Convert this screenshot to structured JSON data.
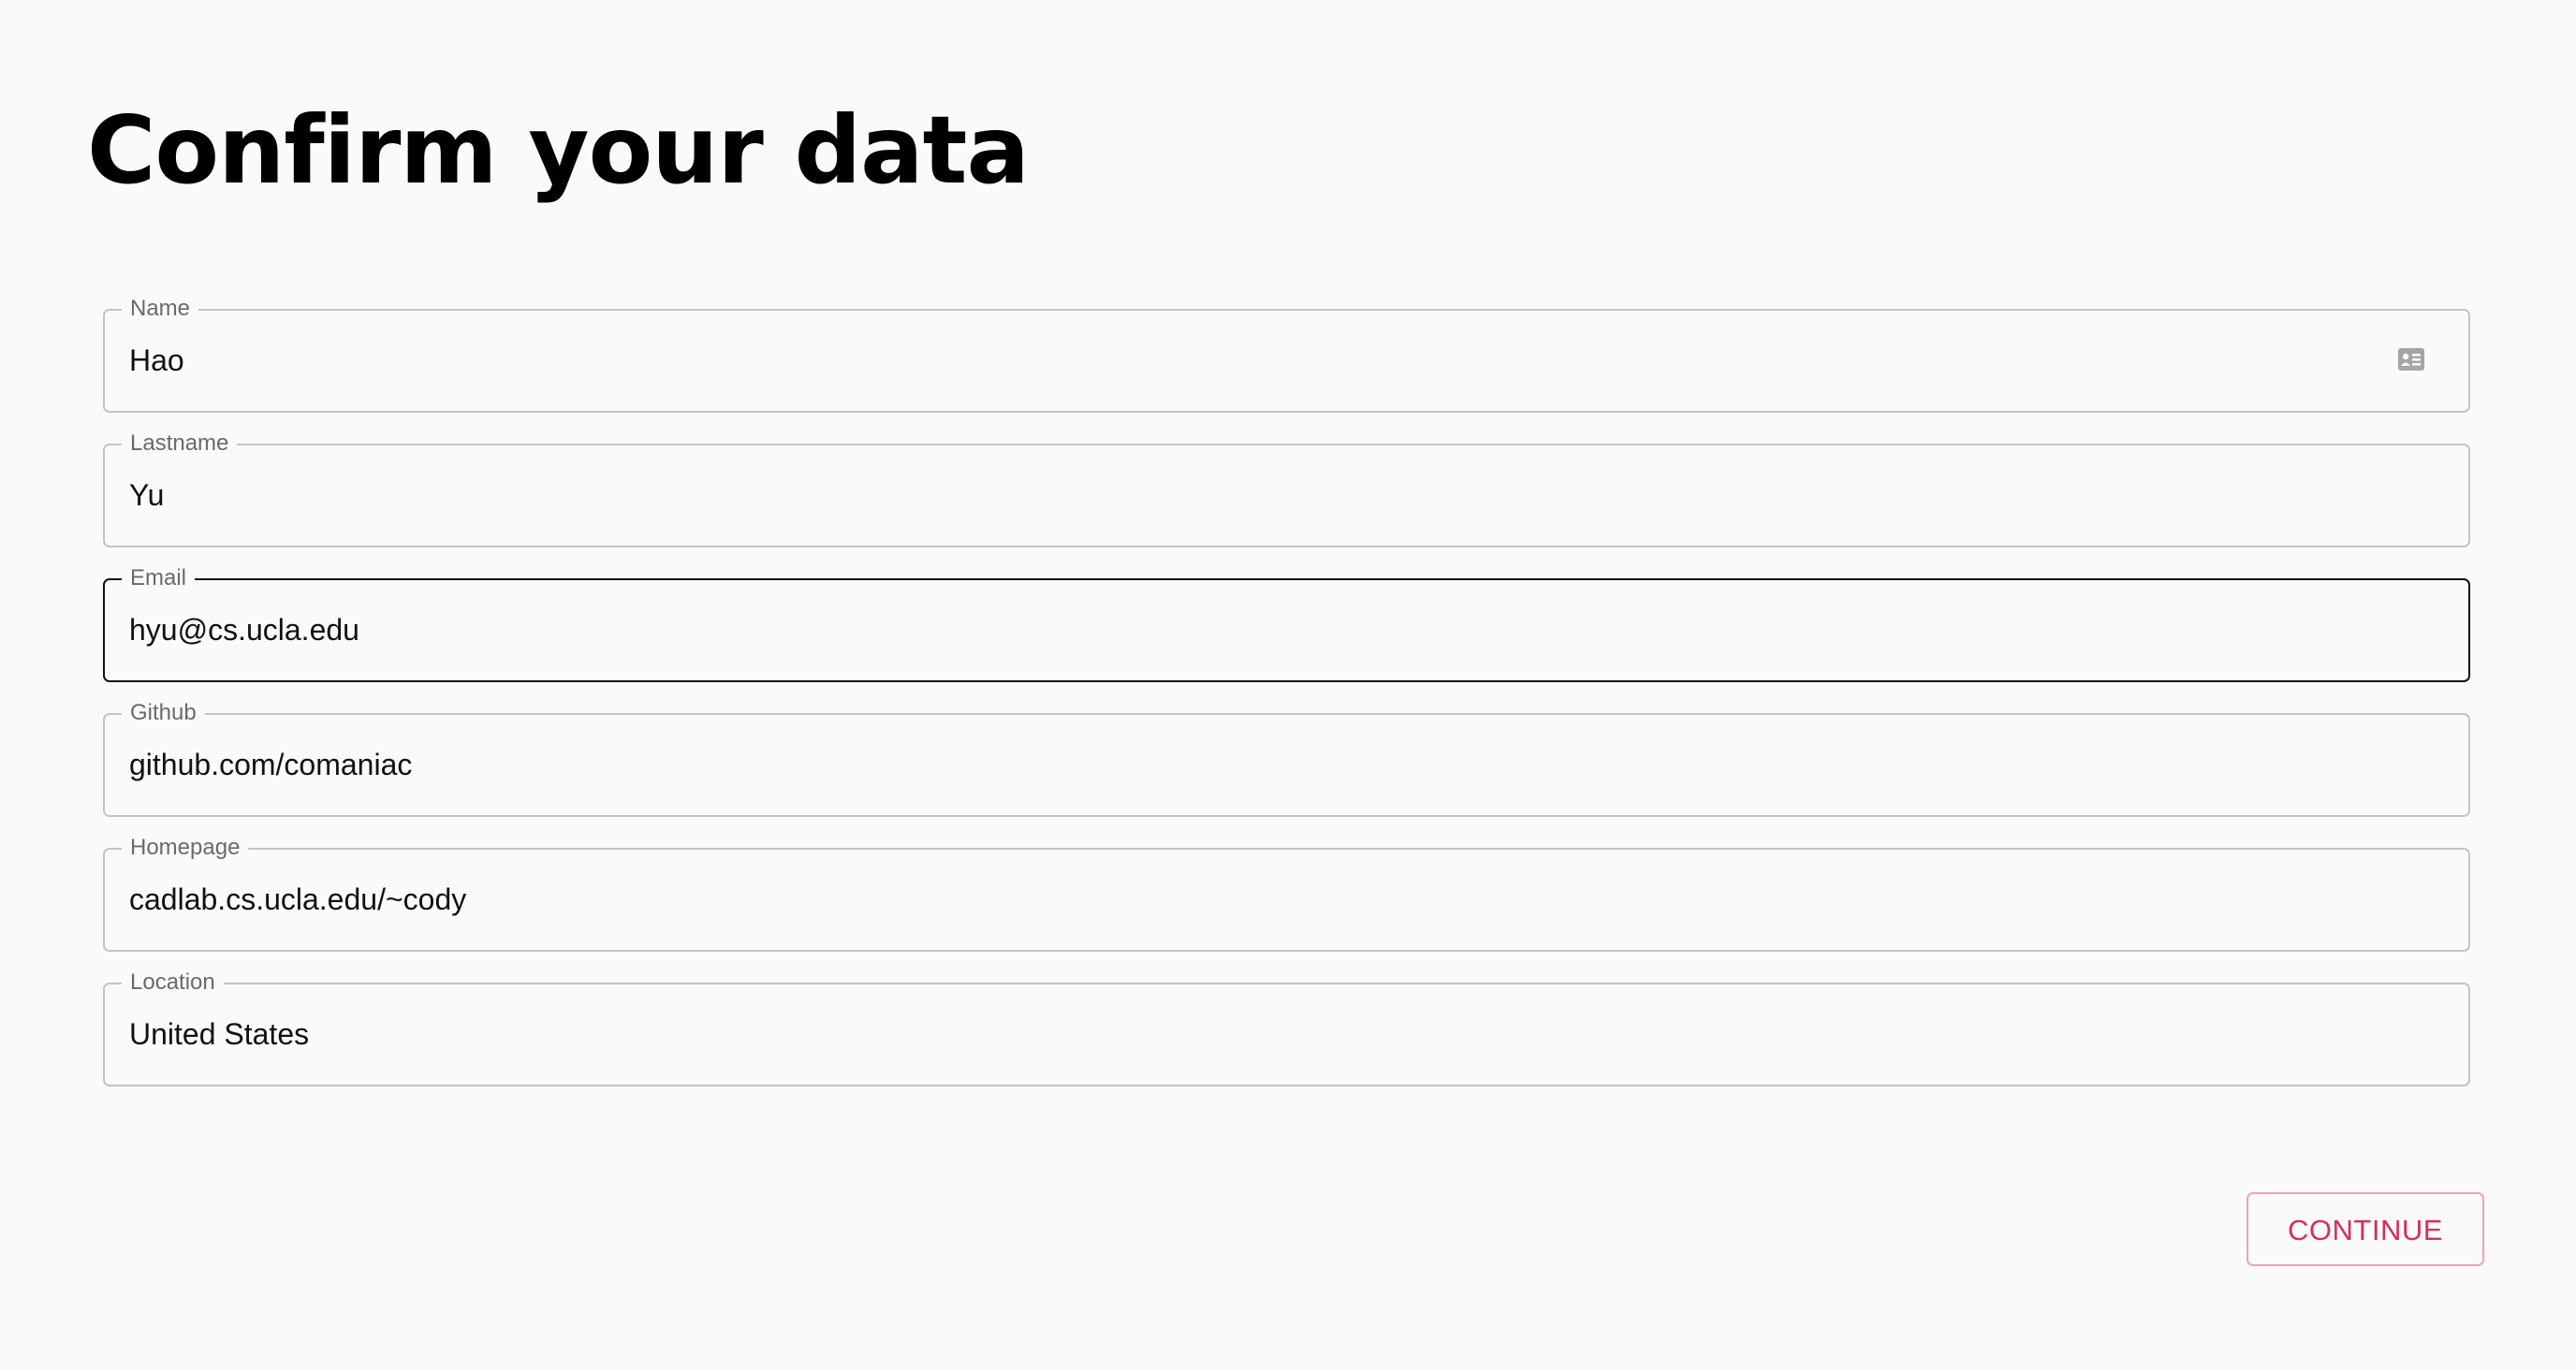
{
  "page": {
    "title": "Confirm your data"
  },
  "form": {
    "fields": [
      {
        "label": "Name",
        "value": "Hao",
        "icon": "contact-card-icon"
      },
      {
        "label": "Lastname",
        "value": "Yu"
      },
      {
        "label": "Email",
        "value": "hyu@cs.ucla.edu",
        "focused": true
      },
      {
        "label": "Github",
        "value": "github.com/comaniac"
      },
      {
        "label": "Homepage",
        "value": "cadlab.cs.ucla.edu/~cody"
      },
      {
        "label": "Location",
        "value": "United States"
      }
    ]
  },
  "actions": {
    "continue_label": "CONTINUE"
  },
  "colors": {
    "background": "#fafafa",
    "field_border": "#c4c4c4",
    "focused_border": "#111111",
    "accent": "#d62f5c",
    "accent_border": "#f0a3b4"
  }
}
